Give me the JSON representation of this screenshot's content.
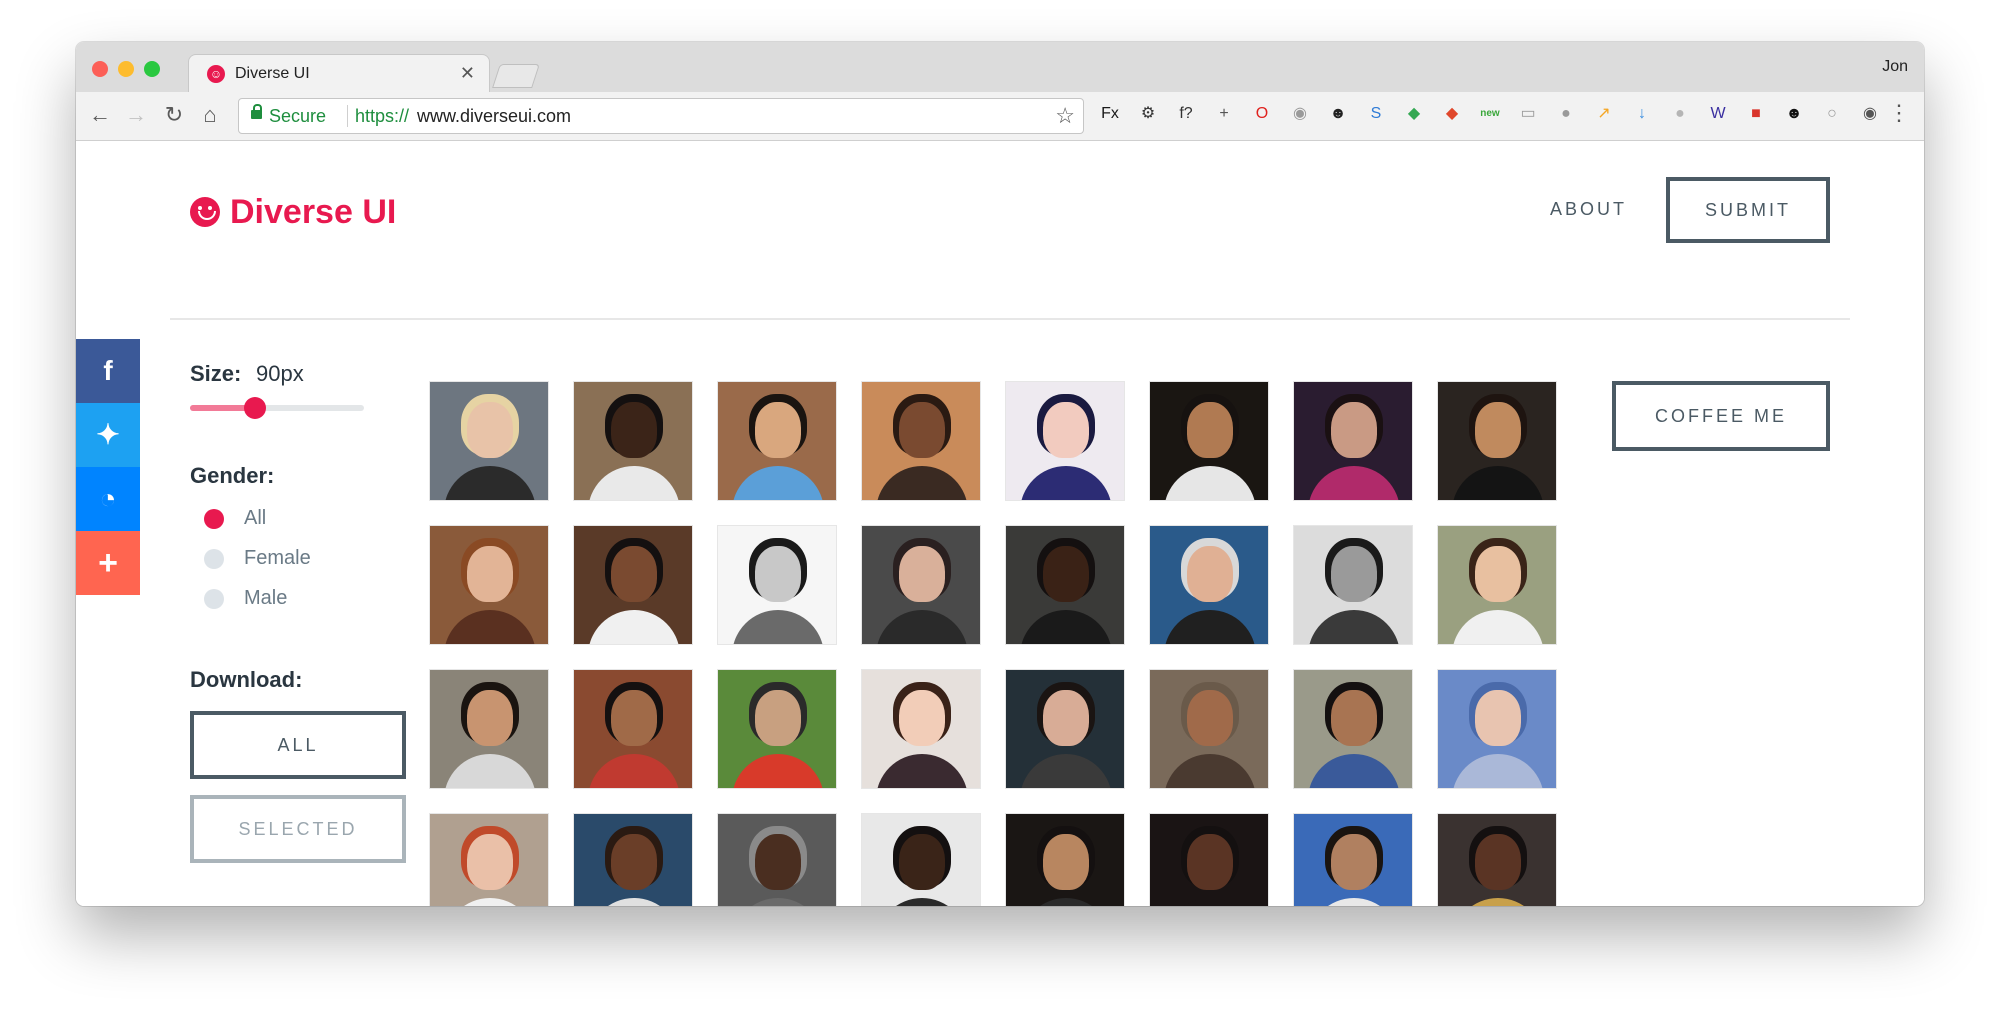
{
  "browser": {
    "tab_title": "Diverse UI",
    "tab_close": "✕",
    "user_name": "Jon",
    "secure_label": "Secure",
    "url_scheme": "https://",
    "url_host": "www.diverseui.com",
    "extensions": [
      {
        "name": "fx-extension-icon",
        "glyph": "Fx",
        "color": "#1a1a1a"
      },
      {
        "name": "gear-extension-icon",
        "glyph": "⚙",
        "color": "#333333"
      },
      {
        "name": "function-extension-icon",
        "glyph": "f?",
        "color": "#333333"
      },
      {
        "name": "crosshair-extension-icon",
        "glyph": "+",
        "color": "#555555"
      },
      {
        "name": "opera-extension-icon",
        "glyph": "O",
        "color": "#e0221e"
      },
      {
        "name": "camera-extension-icon",
        "glyph": "◉",
        "color": "#9a9a9a"
      },
      {
        "name": "panda-extension-icon",
        "glyph": "☻",
        "color": "#222222"
      },
      {
        "name": "s-extension-icon",
        "glyph": "S",
        "color": "#2e7bd6"
      },
      {
        "name": "diamond-extension-icon",
        "glyph": "◆",
        "color": "#35a853"
      },
      {
        "name": "red-diamond-extension-icon",
        "glyph": "◆",
        "color": "#e0472b"
      },
      {
        "name": "new-badge-extension-icon",
        "glyph": "new",
        "color": "#3aa73a"
      },
      {
        "name": "chart-extension-icon",
        "glyph": "▭",
        "color": "#9a9a9a"
      },
      {
        "name": "reddit-extension-icon",
        "glyph": "●",
        "color": "#9a9a9a"
      },
      {
        "name": "analytics-extension-icon",
        "glyph": "↗",
        "color": "#f5a623"
      },
      {
        "name": "download-extension-icon",
        "glyph": "↓",
        "color": "#3d8fe0"
      },
      {
        "name": "dot-extension-icon",
        "glyph": "●",
        "color": "#b5b5b5"
      },
      {
        "name": "w-extension-icon",
        "glyph": "W",
        "color": "#3a2fa0"
      },
      {
        "name": "lock-extension-icon",
        "glyph": "■",
        "color": "#d9342b"
      },
      {
        "name": "face-extension-icon",
        "glyph": "☻",
        "color": "#111111"
      },
      {
        "name": "circle-extension-icon",
        "glyph": "○",
        "color": "#9a9a9a"
      },
      {
        "name": "eye-extension-icon",
        "glyph": "◉",
        "color": "#555555"
      }
    ]
  },
  "header": {
    "brand": "Diverse UI",
    "nav_about": "ABOUT",
    "nav_submit": "SUBMIT"
  },
  "controls": {
    "size_label": "Size:",
    "size_value": "90px",
    "size_fraction": 0.375,
    "gender_label": "Gender:",
    "gender_options": [
      "All",
      "Female",
      "Male"
    ],
    "gender_selected": 0,
    "download_label": "Download:",
    "download_all": "ALL",
    "download_selected": "SELECTED"
  },
  "coffee_label": "COFFEE ME",
  "colors": {
    "brand": "#e8194f",
    "slate": "#4b5a64"
  },
  "avatars": [
    {
      "bg": "#6d7680",
      "skin": "#e8c3a8",
      "hair": "#e6d3a3",
      "shirt": "#2b2b2b"
    },
    {
      "bg": "#8a7055",
      "skin": "#3b2418",
      "hair": "#141010",
      "shirt": "#e9e9e9"
    },
    {
      "bg": "#9a6a4a",
      "skin": "#d9a77e",
      "hair": "#1a1410",
      "shirt": "#5b9fd8"
    },
    {
      "bg": "#c98b5a",
      "skin": "#7a4a30",
      "hair": "#2a1a12",
      "shirt": "#3a2a22"
    },
    {
      "bg": "#eeeaf0",
      "skin": "#f2cbbf",
      "hair": "#1a1a40",
      "shirt": "#2c2c74"
    },
    {
      "bg": "#1a1612",
      "skin": "#b07a52",
      "hair": "#161210",
      "shirt": "#e6e6e6"
    },
    {
      "bg": "#2a1c30",
      "skin": "#c99a84",
      "hair": "#1a1012",
      "shirt": "#b02a6a"
    },
    {
      "bg": "#2a2420",
      "skin": "#c08a5e",
      "hair": "#1e1410",
      "shirt": "#141414"
    },
    {
      "bg": "#8a5a3a",
      "skin": "#e2b496",
      "hair": "#8a4a24",
      "shirt": "#5a3020"
    },
    {
      "bg": "#5a3a28",
      "skin": "#7a4a30",
      "hair": "#141010",
      "shirt": "#f0f0f0"
    },
    {
      "bg": "#f6f6f6",
      "skin": "#c8c8c8",
      "hair": "#1a1a1a",
      "shirt": "#6a6a6a"
    },
    {
      "bg": "#4a4a4a",
      "skin": "#d9b09a",
      "hair": "#2a2020",
      "shirt": "#2a2a2a"
    },
    {
      "bg": "#3a3a38",
      "skin": "#3a2216",
      "hair": "#141010",
      "shirt": "#1a1a1a"
    },
    {
      "bg": "#2a5a8a",
      "skin": "#e0b094",
      "hair": "#d8d8d8",
      "shirt": "#202020"
    },
    {
      "bg": "#dcdcdc",
      "skin": "#9a9a9a",
      "hair": "#1a1a1a",
      "shirt": "#3a3a3a"
    },
    {
      "bg": "#9aa080",
      "skin": "#e8c0a0",
      "hair": "#3a2418",
      "shirt": "#f0f0f0"
    },
    {
      "bg": "#8a8478",
      "skin": "#c89470",
      "hair": "#1a1410",
      "shirt": "#d8d8d8"
    },
    {
      "bg": "#8a4a30",
      "skin": "#a06a48",
      "hair": "#141010",
      "shirt": "#c03a30"
    },
    {
      "bg": "#5a8a3a",
      "skin": "#c8a080",
      "hair": "#2a2a2a",
      "shirt": "#d83a2a"
    },
    {
      "bg": "#e6e0dc",
      "skin": "#f2cdb8",
      "hair": "#3a2218",
      "shirt": "#3a2a30"
    },
    {
      "bg": "#243038",
      "skin": "#d8ac96",
      "hair": "#1a1412",
      "shirt": "#3a3a3a"
    },
    {
      "bg": "#7a6a5a",
      "skin": "#a06a4a",
      "hair": "#6a5a4a",
      "shirt": "#4a3a30"
    },
    {
      "bg": "#9a9a8a",
      "skin": "#a87452",
      "hair": "#141010",
      "shirt": "#3a5a9a"
    },
    {
      "bg": "#6a8ac8",
      "skin": "#e8c4b0",
      "hair": "#4a6aaa",
      "shirt": "#aab8d8"
    },
    {
      "bg": "#b0a090",
      "skin": "#eac0a8",
      "hair": "#c04a2a",
      "shirt": "#f0f0f0"
    },
    {
      "bg": "#2a4a6a",
      "skin": "#6a3e28",
      "hair": "#2a1a12",
      "shirt": "#e0e0e0"
    },
    {
      "bg": "#5a5a5a",
      "skin": "#4a2e20",
      "hair": "#8a8a8a",
      "shirt": "#6a6a6a"
    },
    {
      "bg": "#e8e8e8",
      "skin": "#3a2418",
      "hair": "#141010",
      "shirt": "#2a2a2a"
    },
    {
      "bg": "#1a1614",
      "skin": "#b88660",
      "hair": "#141010",
      "shirt": "#2a2a2a"
    },
    {
      "bg": "#1a1414",
      "skin": "#5a3424",
      "hair": "#141010",
      "shirt": "#1a1414"
    },
    {
      "bg": "#3a6ab8",
      "skin": "#b08060",
      "hair": "#1a1410",
      "shirt": "#e8e8e8"
    },
    {
      "bg": "#3a3230",
      "skin": "#5a3424",
      "hair": "#141010",
      "shirt": "#c8a04a"
    }
  ]
}
